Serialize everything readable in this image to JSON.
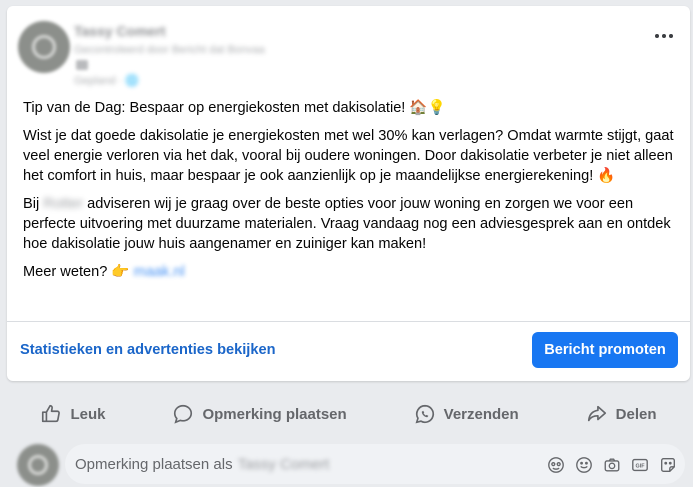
{
  "post": {
    "page_name": "Tassy Comert",
    "subtitle": "Gecontroleerd door Bericht dat Bonvaa",
    "date": "Gepland · 🌐",
    "text": {
      "line1": "Tip van de Dag: Bespaar op energiekosten met dakisolatie! 🏠💡",
      "paragraph2": "Wist je dat goede dakisolatie je energiekosten met wel 30% kan verlagen? Omdat warmte stijgt, gaat veel energie verloren via het dak, vooral bij oudere woningen. Door dakisolatie verbeter je niet alleen het comfort in huis, maar bespaar je ook aanzienlijk op je maandelijkse energierekening! 🔥",
      "p3_prefix": "Bij",
      "p3_blurred": "Rotter",
      "p3_rest": "adviseren wij je graag over de beste opties voor jouw woning en zorgen we voor een perfecte uitvoering met duurzame materialen. Vraag vandaag nog een adviesgesprek aan en ontdek hoe dakisolatie jouw huis aangenamer en zuiniger kan maken!",
      "more_label": "Meer weten? 👉",
      "more_link": "maak.nl"
    }
  },
  "stats": {
    "link_label": "Statistieken en advertenties bekijken",
    "promote_label": "Bericht promoten"
  },
  "actions": [
    {
      "label": "Leuk",
      "icon": "like-icon"
    },
    {
      "label": "Opmerking plaatsen",
      "icon": "comment-icon"
    },
    {
      "label": "Verzenden",
      "icon": "send-icon"
    },
    {
      "label": "Delen",
      "icon": "share-icon"
    }
  ],
  "comment": {
    "placeholder_prefix": "Opmerking plaatsen als",
    "placeholder_name": "Tassy Comert",
    "tools": [
      "avatar-sticker-icon",
      "emoji-icon",
      "camera-icon",
      "gif-icon",
      "sticker-icon"
    ]
  },
  "colors": {
    "accent": "#1877f2",
    "link": "#1b66c9",
    "muted": "#65676b"
  }
}
